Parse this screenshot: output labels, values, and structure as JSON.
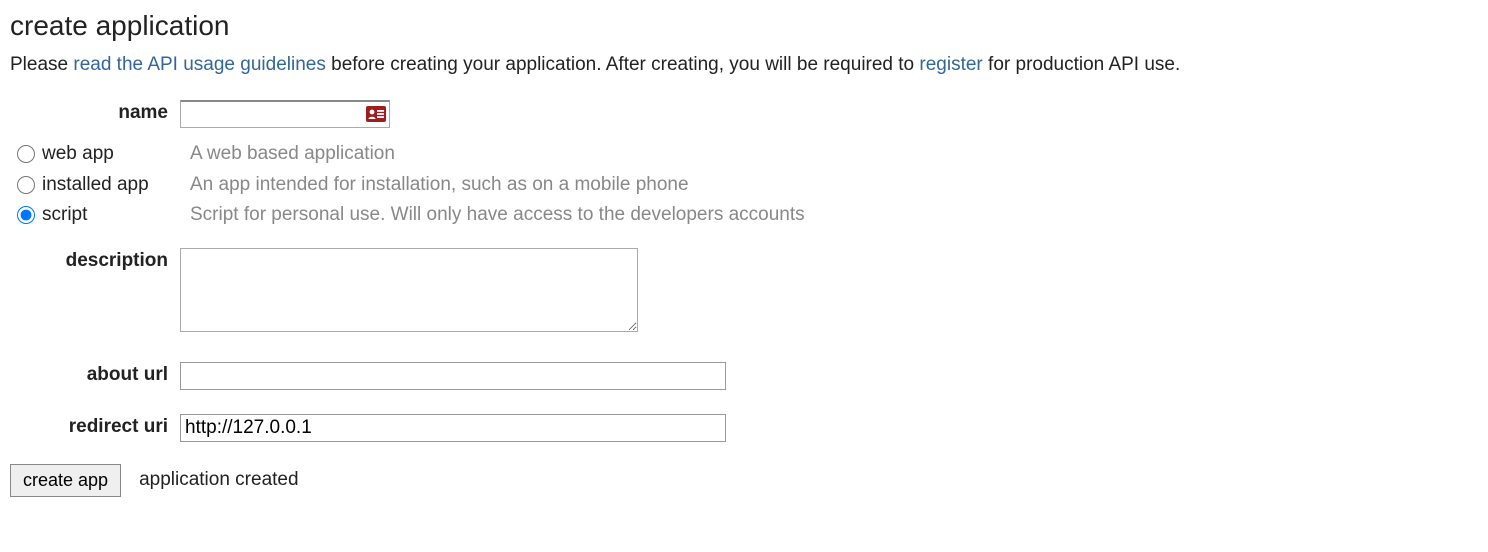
{
  "title": "create application",
  "intro": {
    "prefix": "Please ",
    "link1_text": "read the API usage guidelines",
    "middle": " before creating your application. After creating, you will be required to ",
    "link2_text": "register",
    "suffix": " for production API use."
  },
  "labels": {
    "name": "name",
    "description": "description",
    "about_url": "about url",
    "redirect_uri": "redirect uri"
  },
  "fields": {
    "name_value": "",
    "description_value": "",
    "about_url_value": "",
    "redirect_uri_value": "http://127.0.0.1"
  },
  "app_types": [
    {
      "label": "web app",
      "description": "A web based application",
      "checked": false
    },
    {
      "label": "installed app",
      "description": "An app intended for installation, such as on a mobile phone",
      "checked": false
    },
    {
      "label": "script",
      "description": "Script for personal use. Will only have access to the developers accounts",
      "checked": true
    }
  ],
  "submit_label": "create app",
  "status_message": "application created"
}
